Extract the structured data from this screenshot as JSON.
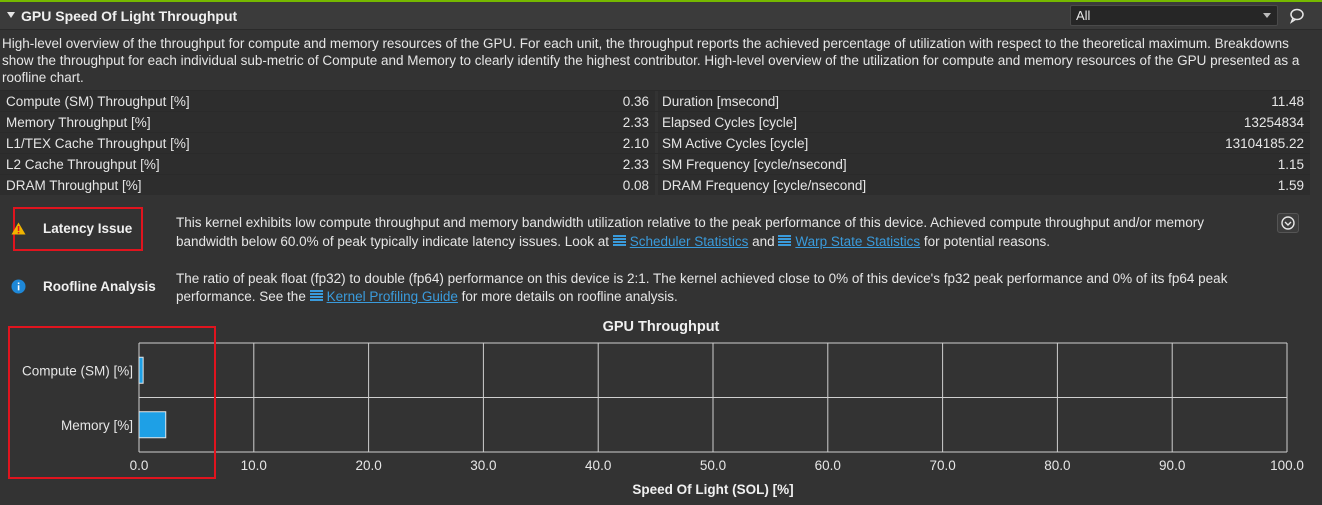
{
  "header": {
    "title": "GPU Speed Of Light Throughput",
    "filter_value": "All"
  },
  "description": "High-level overview of the throughput for compute and memory resources of the GPU. For each unit, the throughput reports the achieved percentage of utilization with respect to the theoretical maximum. Breakdowns show the throughput for each individual sub-metric of Compute and Memory to clearly identify the highest contributor. High-level overview of the utilization for compute and memory resources of the GPU presented as a roofline chart.",
  "metrics": [
    {
      "left_label": "Compute (SM) Throughput [%]",
      "left_value": "0.36",
      "right_label": "Duration [msecond]",
      "right_value": "11.48"
    },
    {
      "left_label": "Memory Throughput [%]",
      "left_value": "2.33",
      "right_label": "Elapsed Cycles [cycle]",
      "right_value": "13254834"
    },
    {
      "left_label": "L1/TEX Cache Throughput [%]",
      "left_value": "2.10",
      "right_label": "SM Active Cycles [cycle]",
      "right_value": "13104185.22"
    },
    {
      "left_label": "L2 Cache Throughput [%]",
      "left_value": "2.33",
      "right_label": "SM Frequency [cycle/nsecond]",
      "right_value": "1.15"
    },
    {
      "left_label": "DRAM Throughput [%]",
      "left_value": "0.08",
      "right_label": "DRAM Frequency [cycle/nsecond]",
      "right_value": "1.59"
    }
  ],
  "latency_rule": {
    "title": "Latency Issue",
    "text_before": "This kernel exhibits low compute throughput and memory bandwidth utilization relative to the peak performance of this device. Achieved compute throughput and/or memory bandwidth below 60.0% of peak typically indicate latency issues. Look at ",
    "link1": "Scheduler Statistics",
    "text_middle": " and ",
    "link2": "Warp State Statistics",
    "text_after": " for potential reasons.",
    "icon": "warning-icon",
    "accent": "#f0b400"
  },
  "roofline_rule": {
    "title": "Roofline Analysis",
    "text_before": "The ratio of peak float (fp32) to double (fp64) performance on this device is 2:1. The kernel achieved close to 0% of this device's fp32 peak performance and 0% of its fp64 peak performance. See the ",
    "link": "Kernel Profiling Guide",
    "text_after": " for more details on roofline analysis.",
    "icon": "info-icon"
  },
  "chart_data": {
    "type": "bar",
    "orientation": "horizontal",
    "title": "GPU Throughput",
    "xlabel": "Speed Of Light (SOL) [%]",
    "ylabel": "",
    "categories": [
      "Compute (SM) [%]",
      "Memory [%]"
    ],
    "values": [
      0.36,
      2.33
    ],
    "xlim": [
      0,
      100
    ],
    "xticks": [
      "0.0",
      "10.0",
      "20.0",
      "30.0",
      "40.0",
      "50.0",
      "60.0",
      "70.0",
      "80.0",
      "90.0",
      "100.0"
    ],
    "grid": true,
    "bar_color": "#1ea0e6"
  },
  "colors": {
    "accent_green": "#76b900",
    "highlight_red": "#e0141e",
    "link_blue": "#3a9bdc"
  }
}
